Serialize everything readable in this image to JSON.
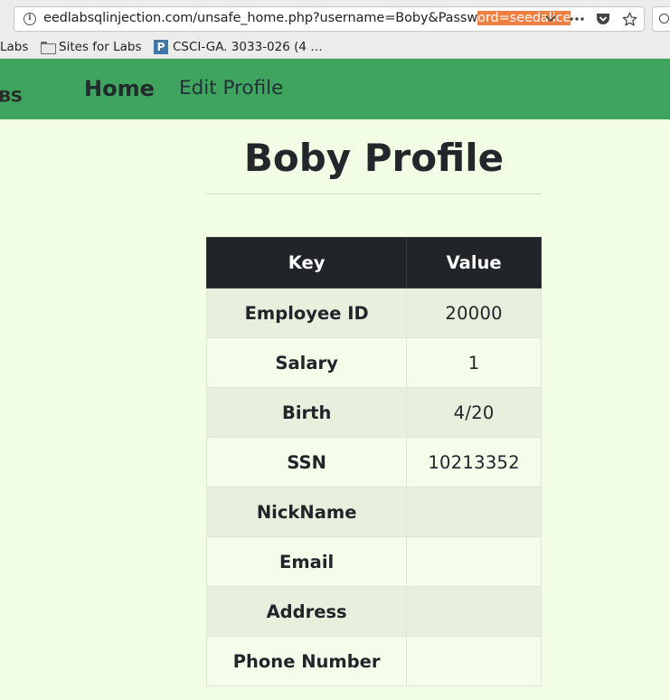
{
  "browser": {
    "url_prefix": "еedlabsqlinjection.com/unsafe_home.php?username=Boby&Passw",
    "url_highlight": "ord=seedalice",
    "bookmarks": [
      {
        "label": "Labs"
      },
      {
        "label": "Sites for Labs"
      },
      {
        "label": "CSCI-GA. 3033-026 (4 …"
      }
    ],
    "piazza_letter": "P"
  },
  "nav": {
    "logo_fragment": "BS",
    "home_label": "Home",
    "edit_profile_label": "Edit Profile",
    "bar_color": "#3fa55e"
  },
  "profile": {
    "title": "Boby Profile",
    "columns": [
      "Key",
      "Value"
    ],
    "rows": [
      {
        "key": "Employee ID",
        "value": "20000"
      },
      {
        "key": "Salary",
        "value": "1"
      },
      {
        "key": "Birth",
        "value": "4/20"
      },
      {
        "key": "SSN",
        "value": "10213352"
      },
      {
        "key": "NickName",
        "value": ""
      },
      {
        "key": "Email",
        "value": ""
      },
      {
        "key": "Address",
        "value": ""
      },
      {
        "key": "Phone Number",
        "value": ""
      }
    ]
  }
}
